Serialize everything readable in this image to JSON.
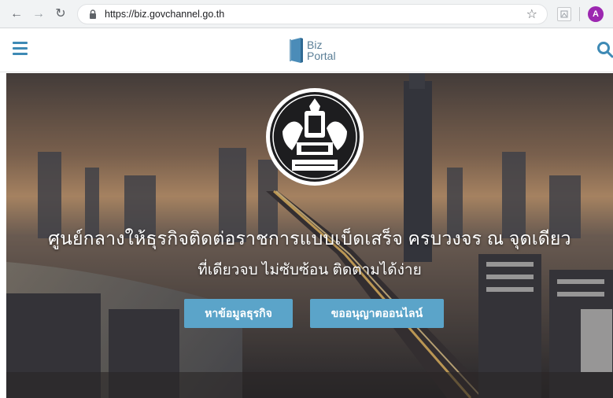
{
  "browser": {
    "url": "https://biz.govchannel.go.th",
    "profile_initial": "A",
    "icons": [
      "back-arrow-icon",
      "forward-arrow-icon",
      "reload-icon",
      "lock-icon",
      "star-icon",
      "extension-icon"
    ]
  },
  "header": {
    "logo_line1": "Biz",
    "logo_line2": "Portal",
    "accent_color": "#3e8ab5"
  },
  "hero": {
    "headline": "ศูนย์กลางให้ธุรกิจติดต่อราชการแบบเบ็ดเสร็จ ครบวงจร ณ จุดเดียว",
    "subline": "ที่เดียวจบ ไม่ซับซ้อน ติดตามได้ง่าย",
    "buttons": {
      "search_business": "หาข้อมูลธุรกิจ",
      "online_license": "ขออนุญาตออนไลน์"
    },
    "button_color": "#5ba4c9"
  }
}
